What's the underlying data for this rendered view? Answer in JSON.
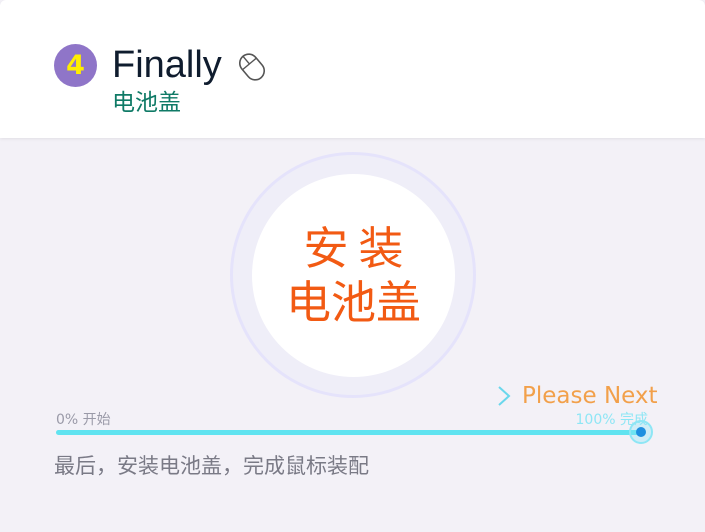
{
  "header": {
    "step_number": "4",
    "title": "Finally",
    "subtitle": "电池盖",
    "title_icon": "mouse-icon"
  },
  "center": {
    "line1": "安装",
    "line2": "电池盖"
  },
  "next_button": {
    "label": "Please Next",
    "icon": "chevron-right-icon"
  },
  "progress": {
    "start_label": "0% 开始",
    "end_label": "100% 完成",
    "value_percent": 100
  },
  "description": "最后，安装电池盖，完成鼠标装配",
  "colors": {
    "badge_bg": "#8f75c8",
    "badge_text": "#ffee00",
    "subtitle": "#0f7a66",
    "center_text": "#f25a13",
    "next_text": "#f2a04a",
    "chevron": "#6ad7ec",
    "progress_track": "#d7f3f8",
    "progress_fill": "#60e3f0",
    "progress_end_label": "#8ee6f5",
    "handle_dot": "#1f8fe0"
  }
}
